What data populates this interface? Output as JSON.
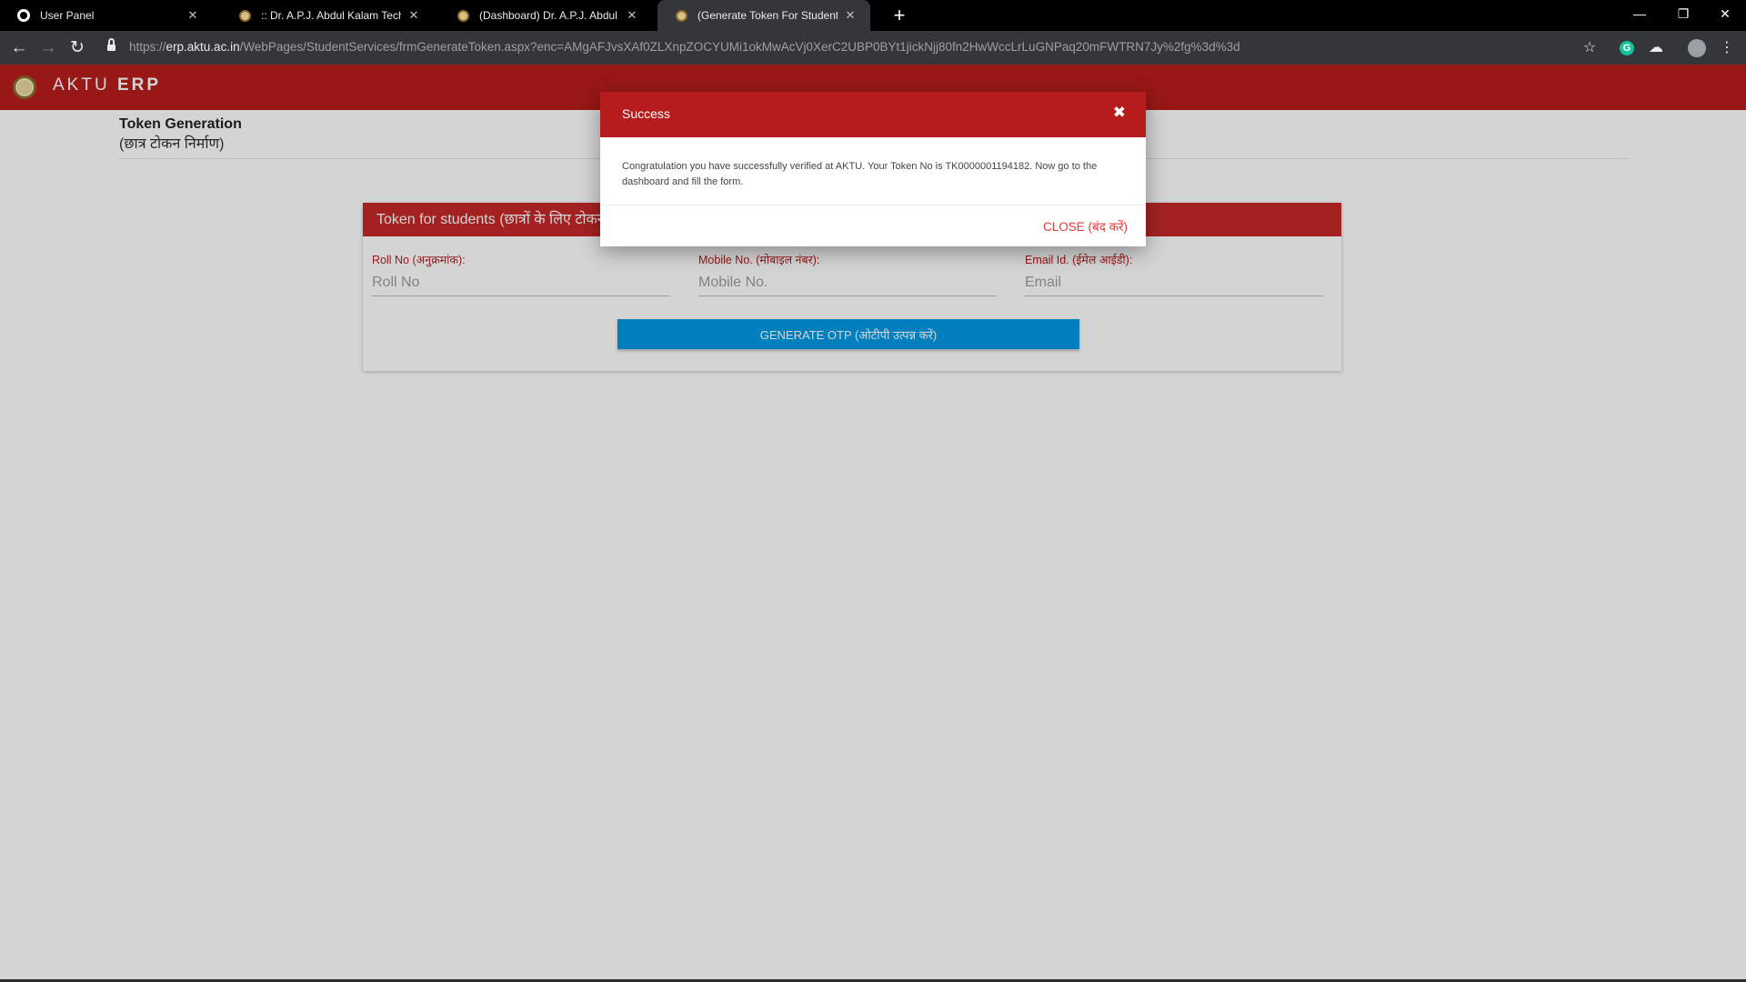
{
  "browser": {
    "tabs": [
      {
        "title": "User Panel",
        "icon": "globe-icon",
        "active": false
      },
      {
        "title": ":: Dr. A.P.J. Abdul Kalam Technical",
        "icon": "aktu-seal-icon",
        "active": false
      },
      {
        "title": "(Dashboard) Dr. A.P.J. Abdul Kala",
        "icon": "aktu-seal-icon",
        "active": false
      },
      {
        "title": "(Generate Token For Student Ser",
        "icon": "aktu-seal-icon",
        "active": true
      }
    ],
    "url": {
      "scheme": "https://",
      "host": "erp.aktu.ac.in",
      "path": "/WebPages/StudentServices/frmGenerateToken.aspx?enc=AMgAFJvsXAf0ZLXnpZOCYUMi1okMwAcVj0XerC2UBP0BYt1jickNjj80fn2HwWccLrLuGNPaq20mFWTRN7Jy%2fg%3d%3d"
    }
  },
  "app": {
    "brand_light": "AKTU",
    "brand_bold": "ERP"
  },
  "page": {
    "title": "Token Generation",
    "subtitle": "(छात्र टोकन निर्माण)"
  },
  "form": {
    "header": "Token for students (छात्रों के लिए टोकन)",
    "roll": {
      "label": "Roll No (अनुक्रमांक):",
      "placeholder": "Roll No",
      "value": ""
    },
    "mobile": {
      "label": "Mobile No. (मोबाइल नंबर):",
      "placeholder": "Mobile No.",
      "value": ""
    },
    "email": {
      "label": "Email Id. (ईमेल आईडी):",
      "placeholder": "Email",
      "value": ""
    },
    "button": "GENERATE OTP (ओटीपी उत्पन्न करें)"
  },
  "modal": {
    "title": "Success",
    "close_glyph": "✖",
    "message": "Congratulation you have successfully verified at AKTU. Your Token No is TK0000001194182. Now go to the dashboard and fill the form.",
    "close_button": "CLOSE (बंद करें)"
  },
  "colors": {
    "brand_red": "#b71c1c",
    "card_header_red": "#c62828",
    "button_blue": "#039be5",
    "close_link_red": "#e53935"
  }
}
